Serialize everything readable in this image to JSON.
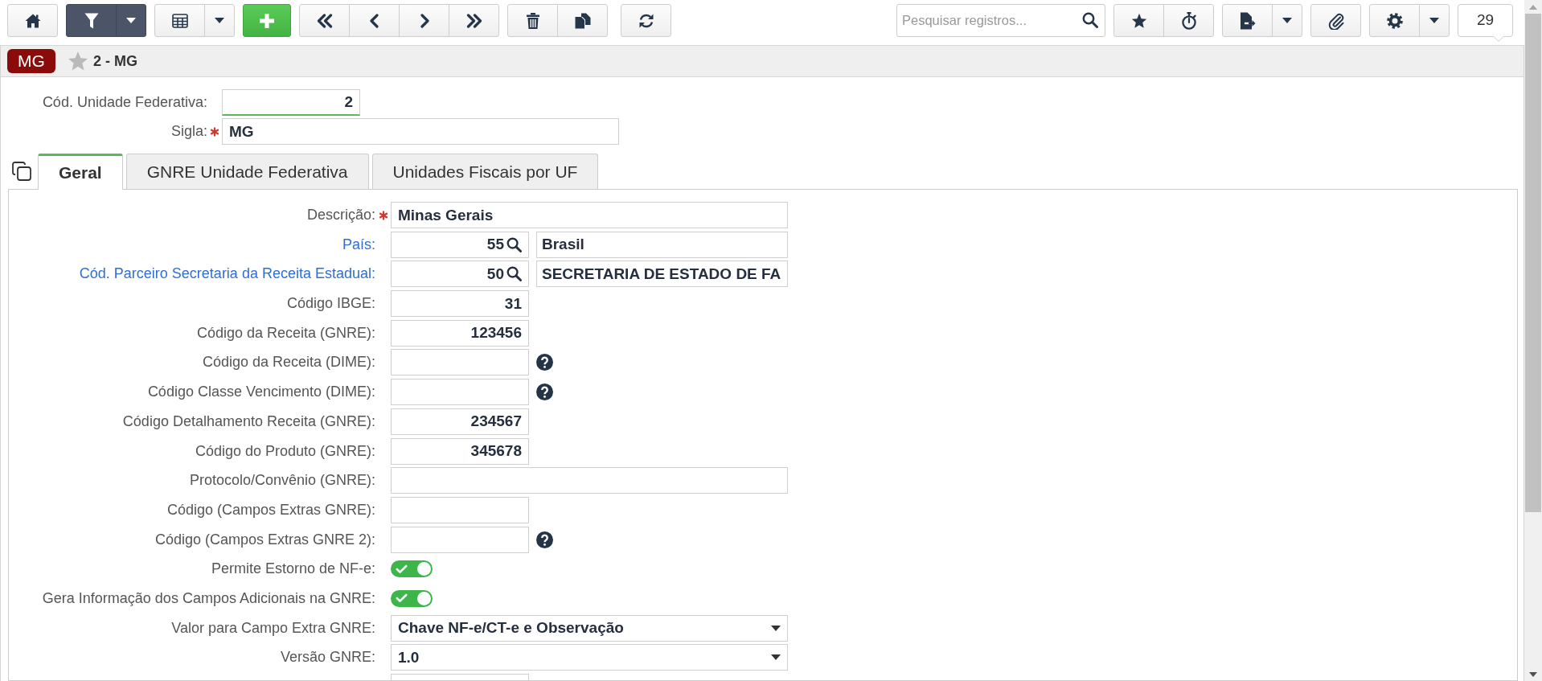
{
  "toolbar": {
    "filter_active": true,
    "search": {
      "placeholder": "Pesquisar registros..."
    },
    "record_count": "29"
  },
  "record_header": {
    "badge": "MG",
    "favorite": false,
    "title": "2 - MG"
  },
  "header_fields": [
    {
      "label": "Cód. Unidade Federativa:",
      "kind": "number",
      "value": "2",
      "required": false,
      "focused": true
    },
    {
      "label": "Sigla:",
      "kind": "text",
      "value": "MG",
      "required": true,
      "focused": false
    }
  ],
  "tabs": [
    {
      "label": "Geral",
      "selected": true
    },
    {
      "label": "GNRE Unidade Federativa",
      "selected": false
    },
    {
      "label": "Unidades Fiscais por UF",
      "selected": false
    }
  ],
  "fields": [
    {
      "label": "Descrição:",
      "kind": "text",
      "value": "Minas Gerais",
      "required": true,
      "link": false,
      "help": false
    },
    {
      "label": "País:",
      "kind": "lookup",
      "code": "55",
      "description": "Brasil",
      "required": false,
      "link": true,
      "help": false
    },
    {
      "label": "Cód. Parceiro Secretaria da Receita Estadual:",
      "kind": "lookup",
      "code": "50",
      "description": "SECRETARIA DE ESTADO DE FA",
      "required": false,
      "link": true,
      "help": false
    },
    {
      "label": "Código IBGE:",
      "kind": "number",
      "value": "31",
      "required": false,
      "link": false,
      "help": false
    },
    {
      "label": "Código da Receita (GNRE):",
      "kind": "number",
      "value": "123456",
      "required": false,
      "link": false,
      "help": false
    },
    {
      "label": "Código da Receita (DIME):",
      "kind": "number",
      "required": false,
      "link": false,
      "help": true
    },
    {
      "label": "Código Classe Vencimento (DIME):",
      "kind": "number",
      "required": false,
      "link": false,
      "help": true
    },
    {
      "label": "Código Detalhamento Receita (GNRE):",
      "kind": "number",
      "value": "234567",
      "required": false,
      "link": false,
      "help": false
    },
    {
      "label": "Código do Produto (GNRE):",
      "kind": "number",
      "value": "345678",
      "required": false,
      "link": false,
      "help": false
    },
    {
      "label": "Protocolo/Convênio (GNRE):",
      "kind": "text",
      "required": false,
      "link": false,
      "help": false
    },
    {
      "label": "Código (Campos Extras GNRE):",
      "kind": "number",
      "required": false,
      "link": false,
      "help": false
    },
    {
      "label": "Código (Campos Extras GNRE 2):",
      "kind": "number",
      "required": false,
      "link": false,
      "help": true
    },
    {
      "label": "Permite Estorno de NF-e:",
      "kind": "toggle",
      "on": true,
      "required": false,
      "link": false,
      "help": false
    },
    {
      "label": "Gera Informação dos Campos Adicionais na GNRE:",
      "kind": "toggle",
      "on": true,
      "required": false,
      "link": false,
      "help": false
    },
    {
      "label": "Valor para Campo Extra GNRE:",
      "kind": "select",
      "value": "Chave NF-e/CT-e e Observação",
      "required": false,
      "link": false,
      "help": false
    },
    {
      "label": "Versão GNRE:",
      "kind": "select",
      "value": "1.0",
      "required": false,
      "link": false,
      "help": false
    },
    {
      "kind": "number"
    }
  ]
}
